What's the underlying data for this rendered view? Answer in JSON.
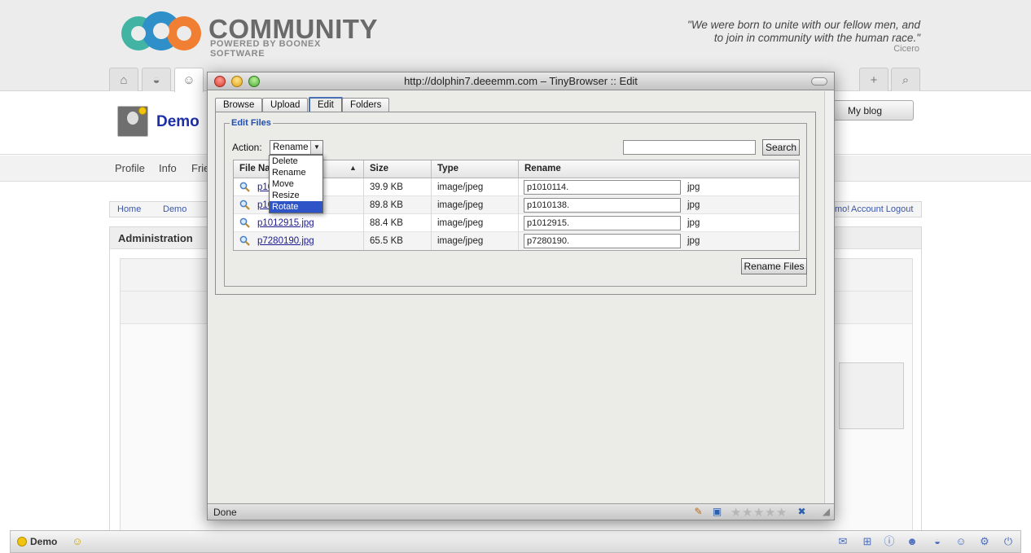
{
  "community": {
    "logo_text": "COMMUNITY",
    "logo_sub": "POWERED BY BOONEX SOFTWARE",
    "quote_line1": "\"We were born to unite with our fellow men, and",
    "quote_line2": "to join in community with the human race.\"",
    "quote_author": "Cicero",
    "profile_name": "Demo",
    "my_blog": "My blog",
    "submenu": [
      "Profile",
      "Info",
      "Frie"
    ],
    "breadcrumb": [
      "Home",
      "Demo"
    ],
    "account_link_partial": "mo!",
    "account_logout": "Account Logout",
    "admin_title": "Administration",
    "bottom_user": "Demo"
  },
  "dialog": {
    "title": "http://dolphin7.deeemm.com – TinyBrowser :: Edit",
    "tabs": [
      "Browse",
      "Upload",
      "Edit",
      "Folders"
    ],
    "active_tab": "Edit",
    "legend": "Edit Files",
    "action_label": "Action:",
    "action_value": "Rename",
    "action_options": [
      "Delete",
      "Rename",
      "Move",
      "Resize",
      "Rotate"
    ],
    "highlighted_option": "Rotate",
    "search_value": "",
    "search_button": "Search",
    "columns": [
      "File Na",
      "Size",
      "Type",
      "Rename"
    ],
    "files": [
      {
        "name": "p10",
        "size": "39.9 KB",
        "type": "image/jpeg",
        "rename": "p1010114.",
        "ext": "jpg"
      },
      {
        "name": "p10",
        "size": "89.8 KB",
        "type": "image/jpeg",
        "rename": "p1010138.",
        "ext": "jpg"
      },
      {
        "name": "p1012915.jpg",
        "size": "88.4 KB",
        "type": "image/jpeg",
        "rename": "p1012915.",
        "ext": "jpg"
      },
      {
        "name": "p7280190.jpg",
        "size": "65.5 KB",
        "type": "image/jpeg",
        "rename": "p7280190.",
        "ext": "jpg"
      }
    ],
    "rename_button": "Rename Files",
    "status": "Done"
  },
  "colors": {
    "accent_blue": "#1f4fb2",
    "selection_blue": "#2f54c7",
    "profile_name": "#1d2fa6"
  },
  "icons": [
    "home-icon",
    "helmet-icon",
    "user-icon",
    "add-icon",
    "search-icon",
    "magnifier-icon",
    "star-icon",
    "settings-icon",
    "power-icon"
  ]
}
